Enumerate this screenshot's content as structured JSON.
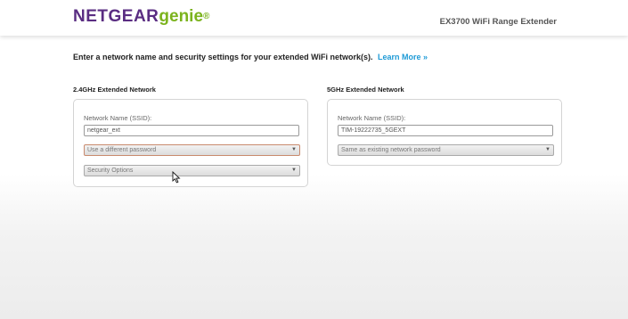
{
  "header": {
    "logo_brand": "NETGEAR",
    "logo_product": "genie",
    "logo_dot": "®",
    "product_name": "EX3700 WiFi Range Extender"
  },
  "intro": {
    "text": "Enter a network name and security settings for your extended WiFi network(s).",
    "link": "Learn More »"
  },
  "network_24": {
    "title": "2.4GHz Extended Network",
    "ssid_label": "Network Name (SSID):",
    "ssid_value": "netgear_ext",
    "password_option": "Use a different password",
    "security_option": "Security Options"
  },
  "network_5": {
    "title": "5GHz Extended Network",
    "ssid_label": "Network Name (SSID):",
    "ssid_value": "TIM-19222735_5GEXT",
    "password_option": "Same as existing network password"
  },
  "colors": {
    "brand_purple": "#5a2d82",
    "genie_green": "#7bb31d",
    "link_blue": "#1e9ad6"
  },
  "icons": {
    "dropdown": "chevron-down-icon",
    "cursor": "mouse-pointer-icon"
  }
}
